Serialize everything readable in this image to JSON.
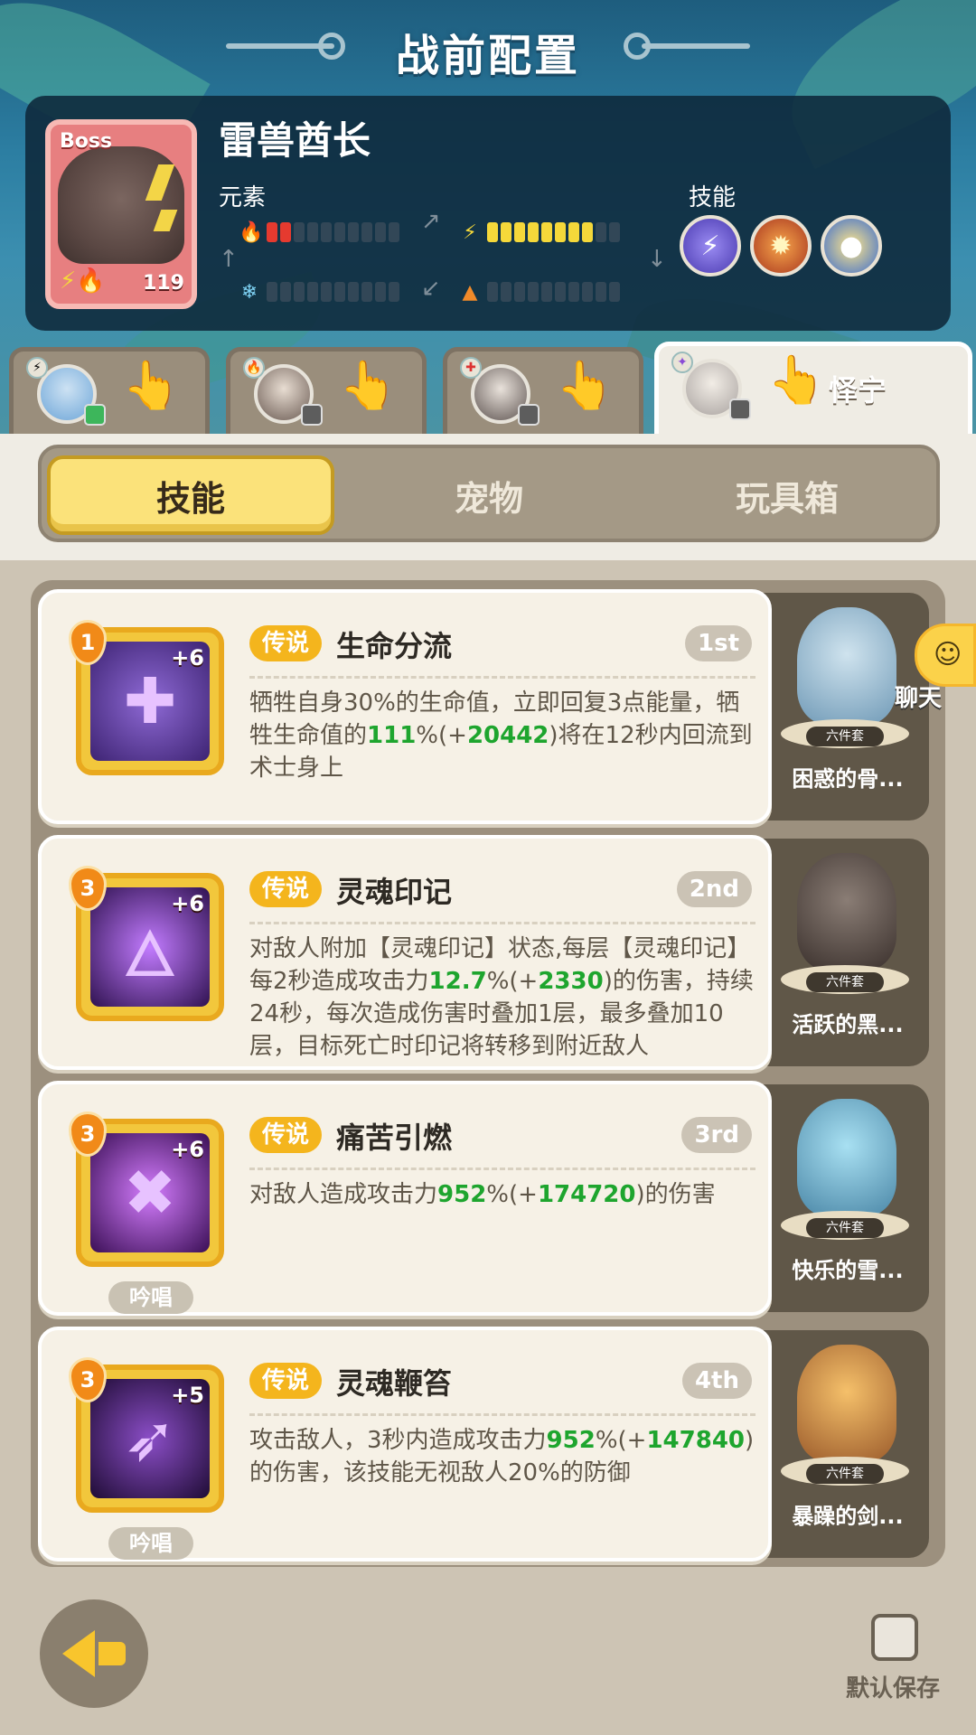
{
  "header": {
    "title": "战前配置"
  },
  "boss": {
    "tag": "Boss",
    "name": "雷兽酋长",
    "level": "119",
    "elements_label": "元素",
    "skills_label": "技能",
    "bars": [
      {
        "icon": "fire-icon",
        "glyph": "🔥",
        "filled": 2,
        "total": 10,
        "color": "#e53a2f"
      },
      {
        "icon": "bolt-icon",
        "glyph": "⚡",
        "filled": 8,
        "total": 10,
        "color": "#f5d83a"
      },
      {
        "icon": "ice-icon",
        "glyph": "❄",
        "filled": 0,
        "total": 10,
        "color": "#7fd3f5"
      },
      {
        "icon": "earth-icon",
        "glyph": "▲",
        "filled": 0,
        "total": 10,
        "color": "#f08a2a"
      }
    ],
    "skill_icons": [
      "lightning-skill-icon",
      "fire-claw-skill-icon",
      "ice-bird-skill-icon"
    ]
  },
  "heroes": [
    {
      "name": "",
      "active": false
    },
    {
      "name": "",
      "active": false
    },
    {
      "name": "",
      "active": false
    },
    {
      "name": "怿宁",
      "active": true
    }
  ],
  "tabs": [
    {
      "label": "技能",
      "active": true
    },
    {
      "label": "宠物",
      "active": false
    },
    {
      "label": "玩具箱",
      "active": false
    }
  ],
  "skills": [
    {
      "level": "1",
      "plus": "+6",
      "rarity": "传说",
      "name": "生命分流",
      "rank": "1st",
      "chant": "",
      "desc": [
        {
          "t": "牺牲自身30%的生命值，立即回复3点能量，牺牲生命值的"
        },
        {
          "t": "111",
          "g": true
        },
        {
          "t": "%(+"
        },
        {
          "t": "20442",
          "g": true
        },
        {
          "t": ")将在12秒内回流到术士身上"
        }
      ],
      "pet": {
        "name": "困惑的骨...",
        "set": "六件套"
      }
    },
    {
      "level": "3",
      "plus": "+6",
      "rarity": "传说",
      "name": "灵魂印记",
      "rank": "2nd",
      "chant": "",
      "desc": [
        {
          "t": "对敌人附加【灵魂印记】状态,每层【灵魂印记】每2秒造成攻击力"
        },
        {
          "t": "12.7",
          "g": true
        },
        {
          "t": "%(+"
        },
        {
          "t": "2330",
          "g": true
        },
        {
          "t": ")的伤害，持续24秒，每次造成伤害时叠加1层，最多叠加10层，目标死亡时印记将转移到附近敌人"
        }
      ],
      "pet": {
        "name": "活跃的黑...",
        "set": "六件套"
      }
    },
    {
      "level": "3",
      "plus": "+6",
      "rarity": "传说",
      "name": "痛苦引燃",
      "rank": "3rd",
      "chant": "吟唱",
      "desc": [
        {
          "t": "对敌人造成攻击力"
        },
        {
          "t": "952",
          "g": true
        },
        {
          "t": "%(+"
        },
        {
          "t": "174720",
          "g": true
        },
        {
          "t": ")的伤害"
        }
      ],
      "pet": {
        "name": "快乐的雪...",
        "set": "六件套"
      }
    },
    {
      "level": "3",
      "plus": "+5",
      "rarity": "传说",
      "name": "灵魂鞭笞",
      "rank": "4th",
      "chant": "吟唱",
      "desc": [
        {
          "t": "攻击敌人，3秒内造成攻击力"
        },
        {
          "t": "952",
          "g": true
        },
        {
          "t": "%(+"
        },
        {
          "t": "147840",
          "g": true
        },
        {
          "t": ")的伤害，该技能无视敌人20%的防御"
        }
      ],
      "pet": {
        "name": "暴躁的剑...",
        "set": "六件套"
      }
    }
  ],
  "chat": {
    "label": "聊天"
  },
  "footer": {
    "save_label": "默认保存"
  }
}
